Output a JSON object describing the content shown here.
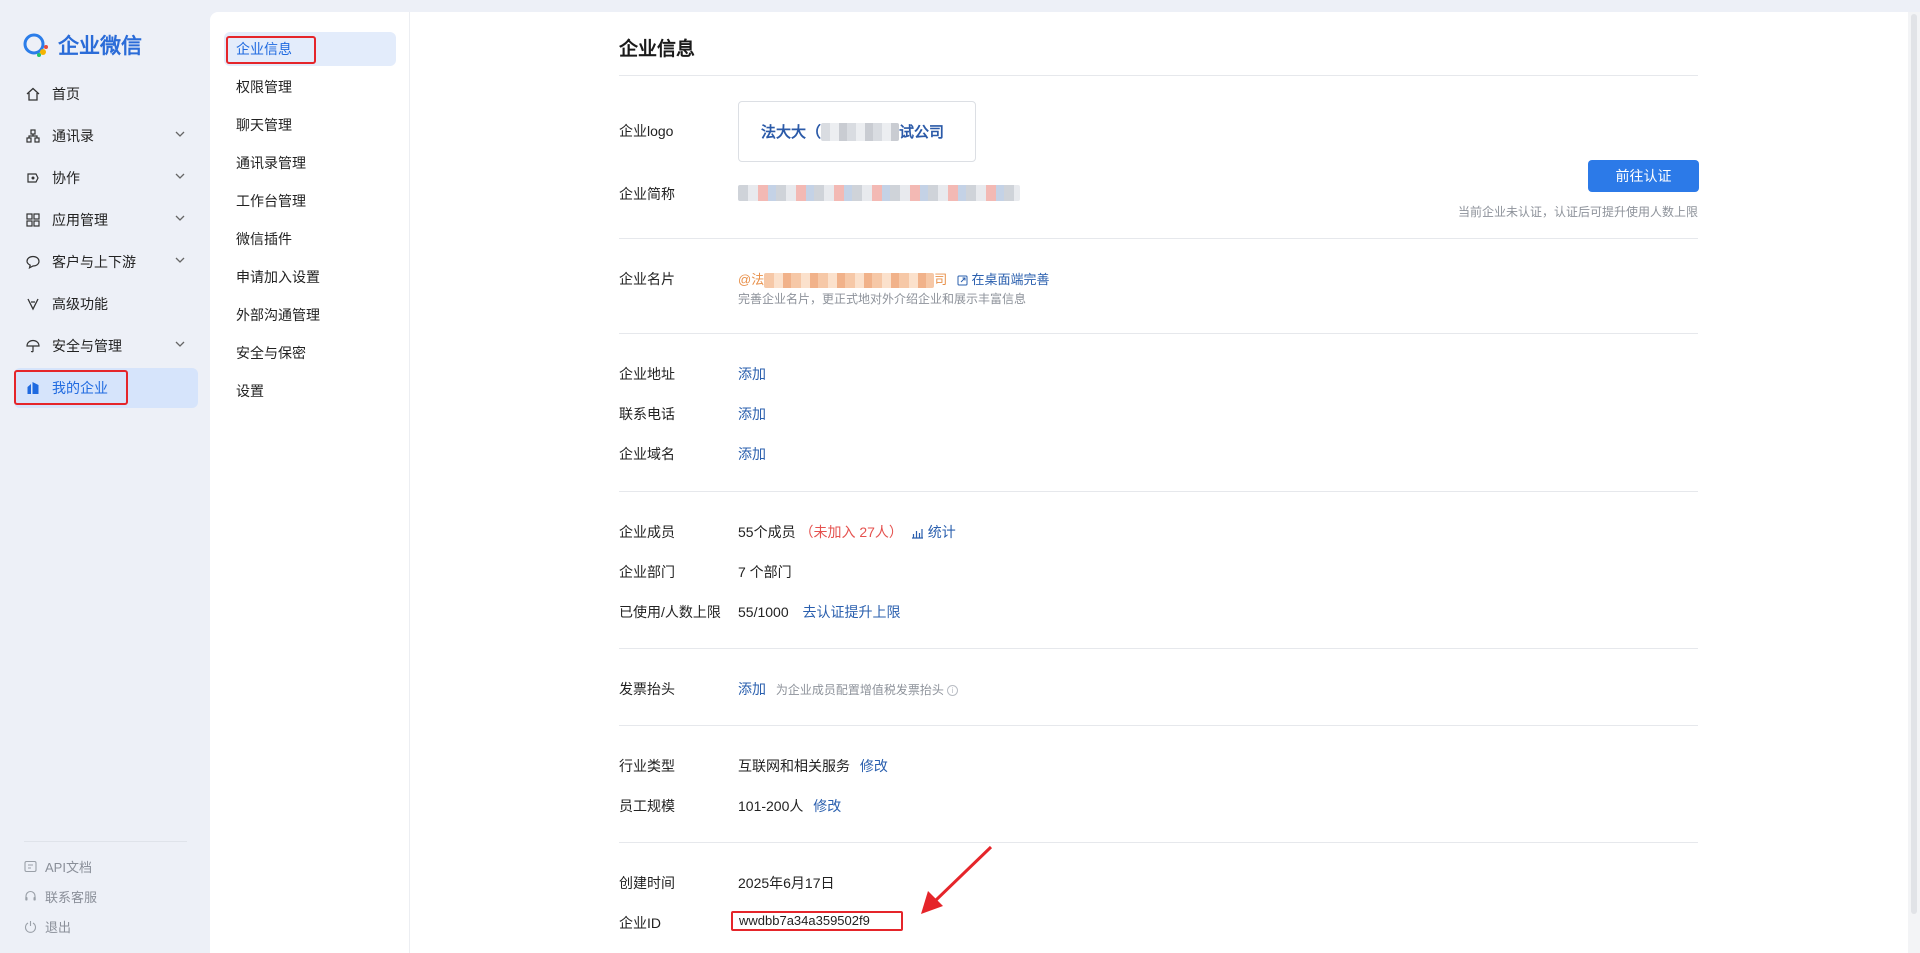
{
  "brand": {
    "name": "企业微信"
  },
  "nav": {
    "items": [
      {
        "label": "首页",
        "icon": "home-icon"
      },
      {
        "label": "通讯录",
        "icon": "org-chart-icon",
        "has_chevron": true
      },
      {
        "label": "协作",
        "icon": "collaboration-icon",
        "has_chevron": true
      },
      {
        "label": "应用管理",
        "icon": "apps-grid-icon",
        "has_chevron": true
      },
      {
        "label": "客户与上下游",
        "icon": "chat-bubble-icon",
        "has_chevron": true
      },
      {
        "label": "高级功能",
        "icon": "sparkle-icon"
      },
      {
        "label": "安全与管理",
        "icon": "umbrella-icon",
        "has_chevron": true
      },
      {
        "label": "我的企业",
        "icon": "building-icon",
        "active": true
      }
    ],
    "footer": [
      {
        "label": "API文档",
        "icon": "api-doc-icon"
      },
      {
        "label": "联系客服",
        "icon": "headset-icon"
      },
      {
        "label": "退出",
        "icon": "power-icon"
      }
    ]
  },
  "submenu": {
    "items": [
      {
        "label": "企业信息",
        "active": true
      },
      {
        "label": "权限管理"
      },
      {
        "label": "聊天管理"
      },
      {
        "label": "通讯录管理"
      },
      {
        "label": "工作台管理"
      },
      {
        "label": "微信插件"
      },
      {
        "label": "申请加入设置"
      },
      {
        "label": "外部沟通管理"
      },
      {
        "label": "安全与保密"
      },
      {
        "label": "设置"
      }
    ]
  },
  "main": {
    "title": "企业信息",
    "logo": {
      "label": "企业logo",
      "text_start": "法大大（",
      "text_end": "试公司"
    },
    "short_name": {
      "label": "企业简称"
    },
    "verify": {
      "button": "前往认证",
      "hint": "当前企业未认证，认证后可提升使用人数上限"
    },
    "card": {
      "label": "企业名片",
      "prefix": "@法",
      "suffix": "司",
      "link": "在桌面端完善",
      "desc": "完善企业名片，更正式地对外介绍企业和展示丰富信息"
    },
    "address": {
      "label": "企业地址",
      "action": "添加"
    },
    "phone": {
      "label": "联系电话",
      "action": "添加"
    },
    "domain": {
      "label": "企业域名",
      "action": "添加"
    },
    "members": {
      "label": "企业成员",
      "count": "55个成员",
      "not_joined": "（未加入 27人）",
      "stats_link": "统计"
    },
    "departments": {
      "label": "企业部门",
      "value": "7 个部门"
    },
    "limit": {
      "label": "已使用/人数上限",
      "value": "55/1000",
      "link": "去认证提升上限"
    },
    "invoice": {
      "label": "发票抬头",
      "action": "添加",
      "hint": "为企业成员配置增值税发票抬头"
    },
    "industry": {
      "label": "行业类型",
      "value": "互联网和相关服务",
      "action": "修改"
    },
    "scale": {
      "label": "员工规模",
      "value": "101-200人",
      "action": "修改"
    },
    "created": {
      "label": "创建时间",
      "value": "2025年6月17日"
    },
    "corp_id": {
      "label": "企业ID",
      "value": "wwdbb7a34a359502f9"
    }
  },
  "colors": {
    "accent": "#2c7ae8",
    "link": "#2a5fae",
    "highlight_red": "#e5252a",
    "nav_active_bg": "#d6e4fb"
  }
}
